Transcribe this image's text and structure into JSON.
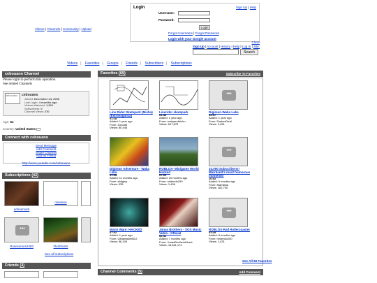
{
  "top_links": {
    "videos": "Videos",
    "channels": "Channels",
    "community": "Community",
    "upload": "Upload"
  },
  "login": {
    "title": "Login",
    "signup": "Sign Up",
    "help": "Help",
    "username_label": "Username:",
    "password_label": "Password:",
    "button": "Login",
    "forgot_user": "Forgot Username",
    "forgot_pass": "Forgot Password",
    "google": "Login with your Google account"
  },
  "utility": {
    "close": "Close",
    "signup": "Sign Up",
    "account": "Account",
    "history": "History",
    "help": "Help",
    "login": "Log In",
    "site": "Site:"
  },
  "search": {
    "button": "Search"
  },
  "nav": [
    "Videos",
    "Favorites",
    "Groups",
    "Friends",
    "Subscribers",
    "Subscriptions"
  ],
  "channel": {
    "header": "cebouano Channel",
    "msg1": "Please login to perform this operation.",
    "msg2": "See related Channels",
    "avatar_alt": "cebouano",
    "name": "cebouano",
    "joined_label": "Joined:",
    "joined": "December 24, 2006",
    "login_label": "Last Login:",
    "login": "4 months ago",
    "watched_label": "Videos Watched:",
    "watched": "1,521",
    "subs_label": "Subscribers:",
    "subs": "0",
    "views_label": "Channel Views:",
    "views": "270",
    "age_label": "Age:",
    "age": "51",
    "country_label": "Country:",
    "country": "United States"
  },
  "connect": {
    "header": "Connect with cebouano",
    "links": [
      "Send Message",
      "Add Comment",
      "Share Channel",
      "Add as Friend"
    ],
    "url": "http://www.youtube.com/cebouano"
  },
  "subscriptions": {
    "header": "Subscriptions",
    "count": "(42)",
    "items": [
      "adrianmark",
      "nineteen",
      "Rosesomes2483",
      "Fleshbrets"
    ],
    "see_all": "See all subscriptions"
  },
  "friends": {
    "header": "Friends",
    "count": "(3)"
  },
  "favorites": {
    "header": "Favorites",
    "count": "(69)",
    "subscribe": "Subscribe To Favorites",
    "see_all": "See All 69 Favorites",
    "videos": [
      {
        "title": "Line Rider Skatepark (Misha) (Extravaganza)",
        "dur": "01:18",
        "added": "Added: 1 year ago",
        "from": "From: Zorcat5",
        "views": "Views: 80,448"
      },
      {
        "title": "Linerider skatepark",
        "dur": "01:46",
        "added": "Added: 1 year ago",
        "from": "From: mnkyandtrichn",
        "views": "Views: 617,875"
      },
      {
        "title": "Digimon-Waka Laka",
        "dur": "04:57",
        "added": "Added: 1 year ago",
        "from": "From: DarkesDevil",
        "views": "Views: 2,051"
      },
      {
        "title": "Digimon Adventure - Waka Laka",
        "dur": "01:28",
        "added": "Added: 11 months ago",
        "from": "From: sfdiginy",
        "views": "Views: 935"
      },
      {
        "title": "ROBLOX- Minigame World Hacked",
        "dur": "07:09",
        "added": "Added: 10 months ago",
        "from": "From: nintendo250",
        "views": "Views: 1,436"
      },
      {
        "title": "10,000 Subscribers!! Marriland's most humorous moments!",
        "dur": "10:52",
        "added": "Added: 5 months ago",
        "from": "From: Marriland",
        "views": "Views: 162,730"
      },
      {
        "title": "Wario Ware: HACKED",
        "dur": "07:02",
        "added": "Added: 1 year ago",
        "from": "From: Ultramaster8DJ",
        "views": "Views: 56,109"
      },
      {
        "title": "Jonas Brothers - SOS Music Video - Official",
        "dur": "02:41",
        "added": "Added: 7 months ago",
        "from": "From: JonasBrothersMusic",
        "views": "Views: 13,811,174"
      },
      {
        "title": "ROBLOX-Rail Rollercoaster",
        "dur": "03:49",
        "added": "Added: 8 months ago",
        "from": "From: nintendo250",
        "views": "Views: 1,431"
      }
    ]
  },
  "comments": {
    "header": "Channel Comments",
    "count": "(5)",
    "add": "Add Comment"
  }
}
